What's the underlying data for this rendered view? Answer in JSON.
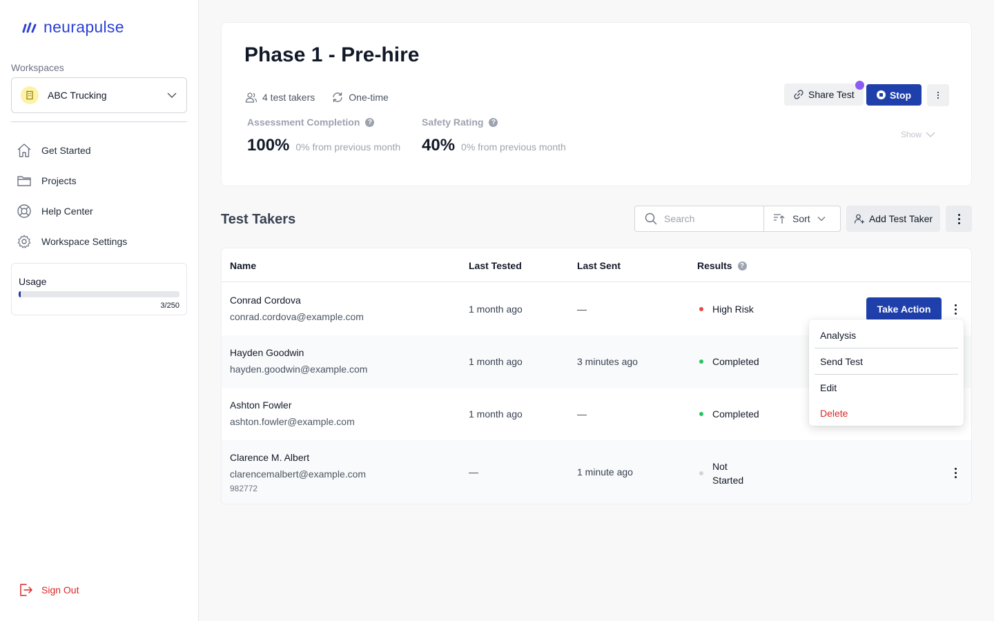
{
  "brand": {
    "name": "neurapulse",
    "color": "#2b3fd6"
  },
  "sidebar": {
    "workspaces_label": "Workspaces",
    "workspace": "ABC Trucking",
    "nav": [
      {
        "label": "Get Started",
        "icon": "home-icon"
      },
      {
        "label": "Projects",
        "icon": "folder-icon"
      },
      {
        "label": "Help Center",
        "icon": "lifebuoy-icon"
      },
      {
        "label": "Workspace Settings",
        "icon": "gear-icon"
      }
    ],
    "usage": {
      "title": "Usage",
      "count": "3/250",
      "used": 3,
      "total": 250
    },
    "sign_out": "Sign Out"
  },
  "header": {
    "title": "Phase 1 - Pre-hire",
    "test_takers": "4 test takers",
    "frequency": "One-time",
    "metrics": [
      {
        "label": "Assessment Completion",
        "value": "100%",
        "sub": "0% from previous month"
      },
      {
        "label": "Safety Rating",
        "value": "40%",
        "sub": "0% from previous month"
      }
    ],
    "share_label": "Share Test",
    "stop_label": "Stop",
    "show_label": "Show"
  },
  "section": {
    "title": "Test Takers",
    "search_placeholder": "Search",
    "sort_label": "Sort",
    "add_label": "Add Test Taker"
  },
  "table": {
    "columns": [
      "Name",
      "Last Tested",
      "Last Sent",
      "Results"
    ],
    "rows": [
      {
        "name": "Conrad Cordova",
        "email": "conrad.cordova@example.com",
        "extra": "",
        "last_tested": "1 month ago",
        "last_sent": "—",
        "result": "High Risk",
        "status_color": "#ef4444",
        "action": "Take Action"
      },
      {
        "name": "Hayden Goodwin",
        "email": "hayden.goodwin@example.com",
        "extra": "",
        "last_tested": "1 month ago",
        "last_sent": "3 minutes ago",
        "result": "Completed",
        "status_color": "#22c55e"
      },
      {
        "name": "Ashton Fowler",
        "email": "ashton.fowler@example.com",
        "extra": "",
        "last_tested": "1 month ago",
        "last_sent": "—",
        "result": "Completed",
        "status_color": "#22c55e"
      },
      {
        "name": "Clarence M. Albert",
        "email": "clarencemalbert@example.com",
        "extra": "982772",
        "last_tested": "—",
        "last_sent": "1 minute ago",
        "result_line1": "Not",
        "result_line2": "Started",
        "status_color": "#d1d5db"
      }
    ]
  },
  "menu": {
    "items": [
      "Analysis",
      "Send Test",
      "Edit",
      "Delete"
    ]
  },
  "colors": {
    "primary": "#1f3fab",
    "danger": "#dc2626",
    "accent_dot": "#8b5cf6"
  }
}
